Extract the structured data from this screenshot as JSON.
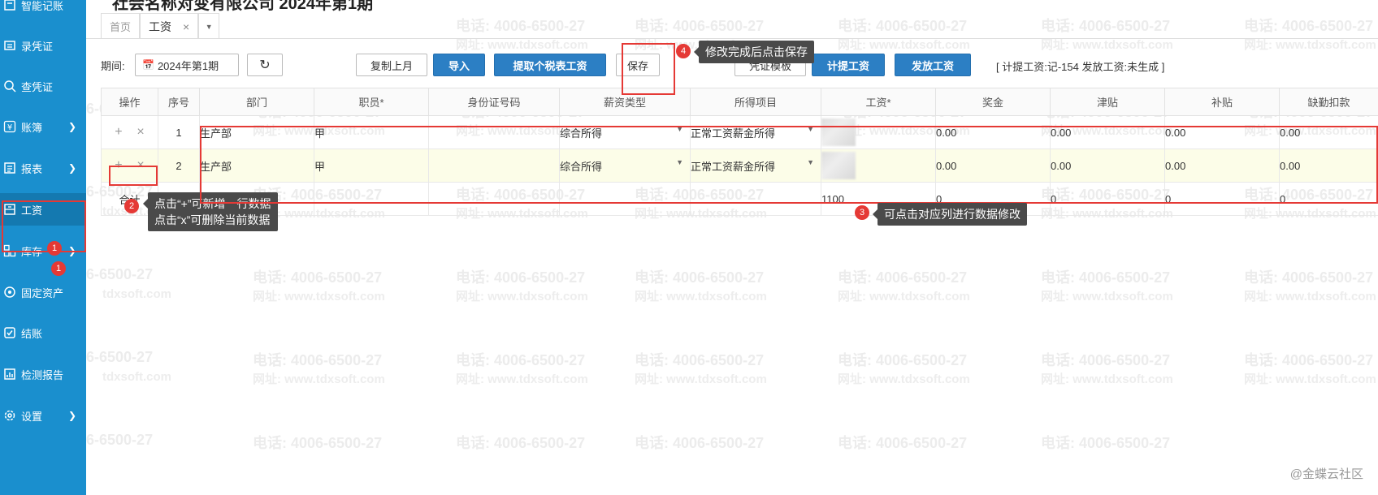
{
  "header": {
    "title_partial": "社会名称对变有限公司 2024年第1期"
  },
  "sidebar": {
    "items": [
      {
        "label": "智能记账",
        "icon": "smart-book-icon"
      },
      {
        "label": "录凭证",
        "icon": "voucher-entry-icon"
      },
      {
        "label": "查凭证",
        "icon": "search-icon"
      },
      {
        "label": "账簿",
        "icon": "yen-icon"
      },
      {
        "label": "报表",
        "icon": "report-icon"
      },
      {
        "label": "工资",
        "icon": "salary-icon"
      },
      {
        "label": "库存",
        "icon": "inventory-icon"
      },
      {
        "label": "固定资产",
        "icon": "fixed-asset-icon"
      },
      {
        "label": "结账",
        "icon": "checkout-icon"
      },
      {
        "label": "检测报告",
        "icon": "detection-icon"
      },
      {
        "label": "设置",
        "icon": "gear-icon"
      }
    ],
    "inventory_badge": "1"
  },
  "tabs": [
    {
      "label": "首页"
    },
    {
      "label": "工资",
      "close": "×"
    }
  ],
  "toolbar": {
    "period_label": "期间:",
    "period_value": "2024年第1期",
    "copy_last_month": "复制上月",
    "import": "导入",
    "fetch_tax_salary": "提取个税表工资",
    "save": "保存",
    "voucher_template": "凭证模板",
    "accrue_salary": "计提工资",
    "pay_salary": "发放工资",
    "status": "[ 计提工资:记-154 发放工资:未生成 ]"
  },
  "table": {
    "headers": [
      "操作",
      "序号",
      "部门",
      "职员*",
      "身份证号码",
      "薪资类型",
      "所得项目",
      "工资*",
      "奖金",
      "津贴",
      "补贴",
      "缺勤扣款"
    ],
    "rows": [
      {
        "ops_add": "+",
        "ops_del": "×",
        "seq": "1",
        "dept": "生产部",
        "employee": "甲",
        "id_no": "",
        "salary_type": "综合所得",
        "income_item": "正常工资薪金所得",
        "salary": "",
        "bonus": "0.00",
        "allowance": "0.00",
        "subsidy": "0.00",
        "absence": "0.00"
      },
      {
        "ops_add": "+",
        "ops_del": "×",
        "seq": "2",
        "dept": "生产部",
        "employee": "甲",
        "id_no": "",
        "salary_type": "综合所得",
        "income_item": "正常工资薪金所得",
        "salary": "",
        "bonus": "0.00",
        "allowance": "0.00",
        "subsidy": "0.00",
        "absence": "0.00"
      }
    ],
    "total": {
      "label": "合计",
      "salary": "1100",
      "bonus": "0",
      "allowance": "0",
      "subsidy": "0",
      "absence": "0"
    }
  },
  "annotations": {
    "n1": "1",
    "n2": "2",
    "tip2_line1": "点击“+”可新增一行数据",
    "tip2_line2": "点击“x”可删除当前数据",
    "n3": "3",
    "tip3": "可点击对应列进行数据修改",
    "n4": "4",
    "tip4": "修改完成后点击保存"
  },
  "watermark": {
    "phone": "电话: 4006-6500-27",
    "url": "网址: www.tdxsoft.com",
    "phone_short": "06-6500-27",
    "url_short": "tdxsoft.com"
  },
  "brand": "@金蝶云社区",
  "colors": {
    "sidebar_bg": "#1a8fce",
    "primary_button": "#2c7fc4",
    "annotation_red": "#e53935",
    "tooltip_bg": "#4a4a4a"
  }
}
